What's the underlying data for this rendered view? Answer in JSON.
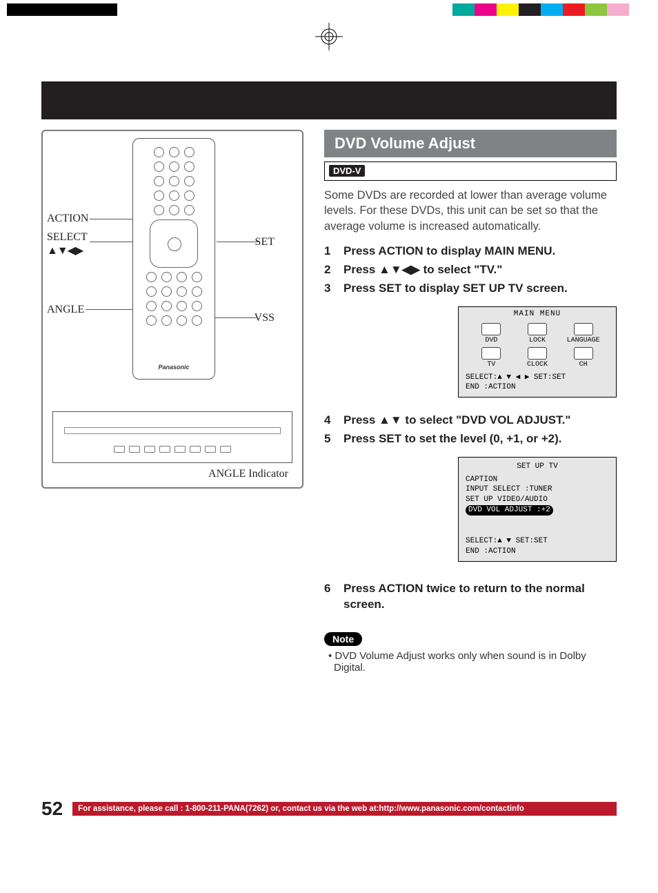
{
  "calibration": {
    "left_colors": [
      "#000000",
      "#000000",
      "#000000",
      "#000000",
      "#000000",
      "#ffffff",
      "#ffffff",
      "#ffffff",
      "#ffffff",
      "#ffffff"
    ],
    "right_colors": [
      "#ffffff",
      "#00a99d",
      "#ec008c",
      "#fff200",
      "#231f20",
      "#00aeef",
      "#ed1c24",
      "#8dc63f",
      "#f6adcd",
      "#ffffff"
    ]
  },
  "figure": {
    "callouts": {
      "action": "ACTION",
      "select": "SELECT",
      "select_arrows": "▲▼◀▶",
      "set": "SET",
      "angle": "ANGLE",
      "vss": "VSS",
      "angle_indicator": "ANGLE Indicator"
    },
    "brand": "Panasonic"
  },
  "section": {
    "title": "DVD Volume Adjust",
    "badge": "DVD-V",
    "intro": "Some DVDs are recorded at lower than average volume levels. For these DVDs, this unit can be set so that the average volume is increased automatically.",
    "steps": [
      "Press ACTION to display MAIN MENU.",
      "Press ▲▼◀▶ to select \"TV.\"",
      "Press SET to display SET UP TV screen.",
      "Press ▲▼ to select \"DVD VOL ADJUST.\"",
      "Press SET to set the level (0, +1, or +2).",
      "Press ACTION twice to return to the normal screen."
    ],
    "osd_main": {
      "title": "MAIN MENU",
      "items": [
        {
          "label": "DVD"
        },
        {
          "label": "LOCK"
        },
        {
          "label": "LANGUAGE"
        },
        {
          "label": "TV"
        },
        {
          "label": "CLOCK"
        },
        {
          "label": "CH"
        }
      ],
      "foot1": "SELECT:▲ ▼ ◀ ▶   SET:SET",
      "foot2": "END   :ACTION"
    },
    "osd_setup": {
      "title": "SET UP TV",
      "lines": [
        "CAPTION",
        "INPUT SELECT   :TUNER",
        "SET UP VIDEO/AUDIO"
      ],
      "highlight": "DVD VOL ADJUST :+2",
      "foot1": "SELECT:▲ ▼        SET:SET",
      "foot2": "END   :ACTION"
    },
    "note_label": "Note",
    "note_text": "• DVD Volume Adjust works only when sound is in Dolby Digital."
  },
  "footer": {
    "page": "52",
    "assist": "For assistance, please call : 1-800-211-PANA(7262) or, contact us via the web at:http://www.panasonic.com/contactinfo"
  }
}
